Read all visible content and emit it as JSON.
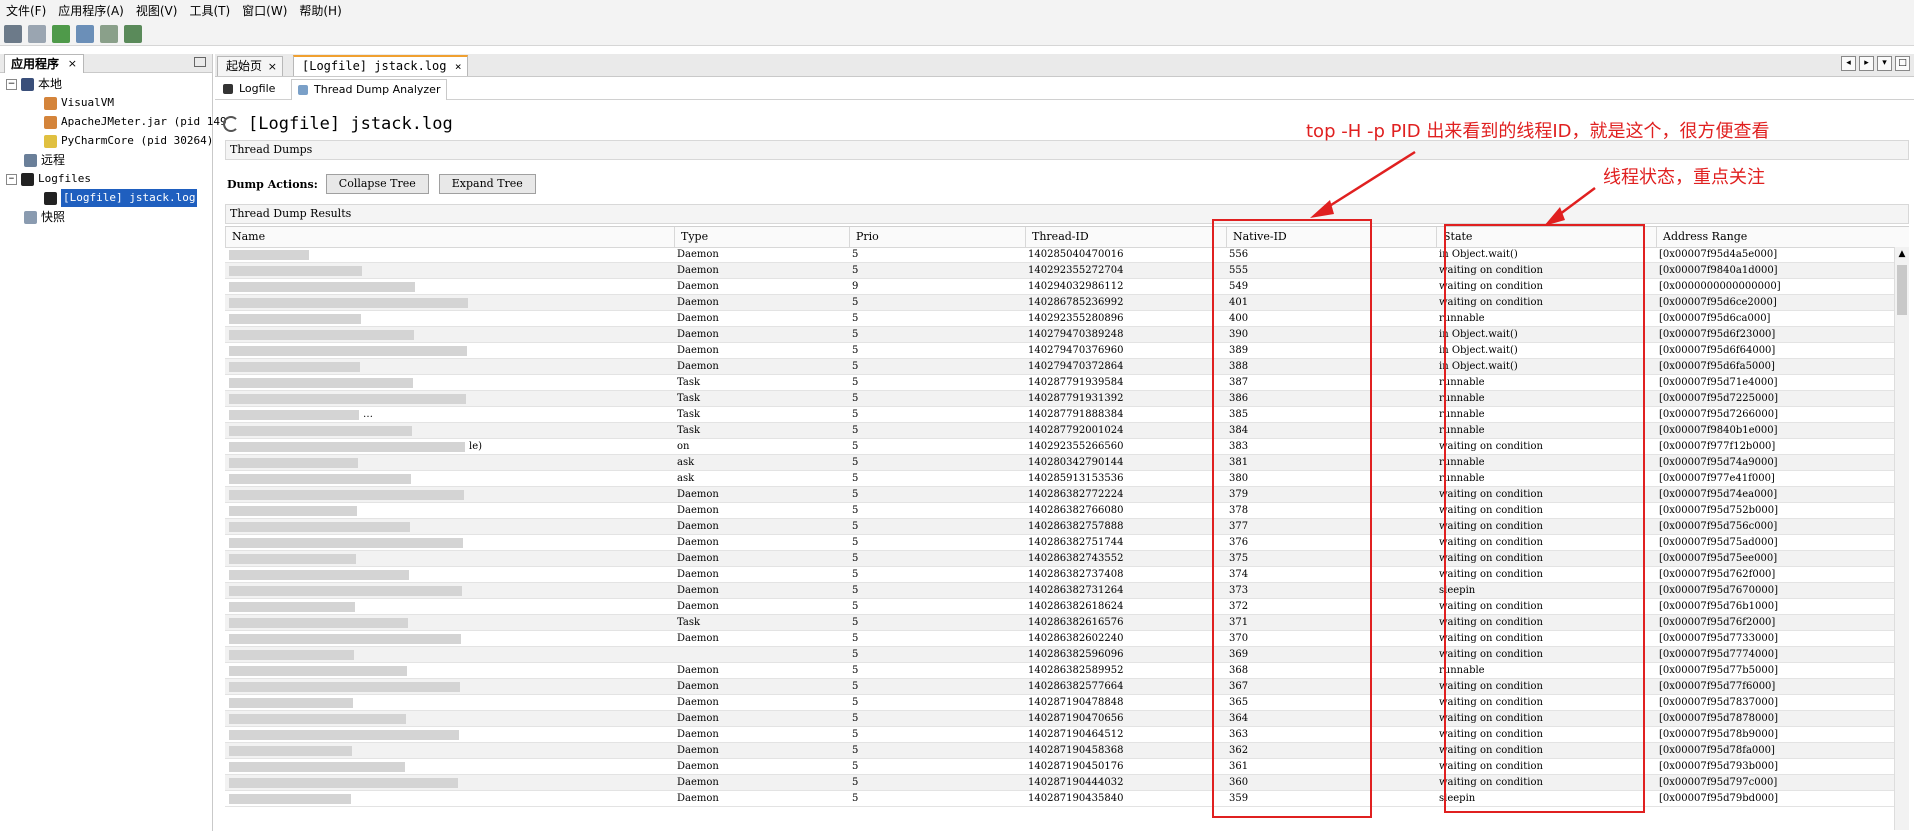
{
  "menu": [
    "文件(F)",
    "应用程序(A)",
    "视图(V)",
    "工具(T)",
    "窗口(W)",
    "帮助(H)"
  ],
  "left_panel": {
    "tab_label": "应用程序",
    "close_glyph": "×",
    "tree": {
      "local": "本地",
      "visualvm": "VisualVM",
      "jmeter": "ApacheJMeter.jar (pid 149",
      "pycharm": "PyCharmCore (pid 30264)",
      "remote": "远程",
      "logfiles": "Logfiles",
      "logfile_item": "[Logfile] jstack.log",
      "snapshots": "快照"
    }
  },
  "editor_tabs": [
    {
      "label": "起始页",
      "close": "×"
    },
    {
      "label": "[Logfile] jstack.log",
      "close": "×"
    }
  ],
  "sub_tabs": [
    "Logfile",
    "Thread Dump Analyzer"
  ],
  "page_title": "[Logfile] jstack.log",
  "thread_dumps_label": "Thread Dumps",
  "dump_actions": {
    "label": "Dump Actions:",
    "collapse": "Collapse Tree",
    "expand": "Expand Tree"
  },
  "results_label": "Thread Dump Results",
  "table": {
    "columns": [
      "Name",
      "Type",
      "Prio",
      "Thread-ID",
      "Native-ID",
      "State",
      "Address Range"
    ],
    "rows": [
      [
        "",
        "Daemon",
        "5",
        "140285040470016",
        "556",
        "in Object.wait()",
        "[0x00007f95d4a5e000]"
      ],
      [
        "",
        "Daemon",
        "5",
        "140292355272704",
        "555",
        "waiting on condition",
        "[0x00007f9840a1d000]"
      ],
      [
        "",
        "Daemon",
        "9",
        "140294032986112",
        "549",
        "waiting on condition",
        "[0x0000000000000000]"
      ],
      [
        "",
        "Daemon",
        "5",
        "140286785236992",
        "401",
        "waiting on condition",
        "[0x00007f95d6ce2000]"
      ],
      [
        "",
        "Daemon",
        "5",
        "140292355280896",
        "400",
        "runnable",
        "[0x00007f95d6ca000]"
      ],
      [
        "",
        "Daemon",
        "5",
        "140279470389248",
        "390",
        "in Object.wait()",
        "[0x00007f95d6f23000]"
      ],
      [
        "",
        "Daemon",
        "5",
        "140279470376960",
        "389",
        "in Object.wait()",
        "[0x00007f95d6f64000]"
      ],
      [
        "",
        "Daemon",
        "5",
        "140279470372864",
        "388",
        "in Object.wait()",
        "[0x00007f95d6fa5000]"
      ],
      [
        "",
        "Task",
        "5",
        "140287791939584",
        "387",
        "runnable",
        "[0x00007f95d71e4000]"
      ],
      [
        "",
        "Task",
        "5",
        "140287791931392",
        "386",
        "runnable",
        "[0x00007f95d7225000]"
      ],
      [
        "…",
        "Task",
        "5",
        "140287791888384",
        "385",
        "runnable",
        "[0x00007f95d7266000]"
      ],
      [
        "",
        "Task",
        "5",
        "140287792001024",
        "384",
        "runnable",
        "[0x00007f9840b1e000]"
      ],
      [
        "le)",
        "on",
        "5",
        "140292355266560",
        "383",
        "waiting on condition",
        "[0x00007f977f12b000]"
      ],
      [
        "",
        "ask",
        "5",
        "140280342790144",
        "381",
        "runnable",
        "[0x00007f95d74a9000]"
      ],
      [
        "",
        "ask",
        "5",
        "140285913153536",
        "380",
        "runnable",
        "[0x00007f977e41f000]"
      ],
      [
        "",
        "Daemon",
        "5",
        "140286382772224",
        "379",
        "waiting on condition",
        "[0x00007f95d74ea000]"
      ],
      [
        "",
        "Daemon",
        "5",
        "140286382766080",
        "378",
        "waiting on condition",
        "[0x00007f95d752b000]"
      ],
      [
        "",
        "Daemon",
        "5",
        "140286382757888",
        "377",
        "waiting on condition",
        "[0x00007f95d756c000]"
      ],
      [
        "",
        "Daemon",
        "5",
        "140286382751744",
        "376",
        "waiting on condition",
        "[0x00007f95d75ad000]"
      ],
      [
        "",
        "Daemon",
        "5",
        "140286382743552",
        "375",
        "waiting on condition",
        "[0x00007f95d75ee000]"
      ],
      [
        "",
        "Daemon",
        "5",
        "140286382737408",
        "374",
        "waiting on condition",
        "[0x00007f95d762f000]"
      ],
      [
        "",
        "Daemon",
        "5",
        "140286382731264",
        "373",
        "sleepin",
        "[0x00007f95d7670000]"
      ],
      [
        "",
        "Daemon",
        "5",
        "140286382618624",
        "372",
        "waiting on condition",
        "[0x00007f95d76b1000]"
      ],
      [
        "",
        "Task",
        "5",
        "140286382616576",
        "371",
        "waiting on condition",
        "[0x00007f95d76f2000]"
      ],
      [
        "",
        "Daemon",
        "5",
        "140286382602240",
        "370",
        "waiting on condition",
        "[0x00007f95d7733000]"
      ],
      [
        "",
        "",
        "5",
        "140286382596096",
        "369",
        "waiting on condition",
        "[0x00007f95d7774000]"
      ],
      [
        "",
        "Daemon",
        "5",
        "140286382589952",
        "368",
        "runnable",
        "[0x00007f95d77b5000]"
      ],
      [
        "",
        "Daemon",
        "5",
        "140286382577664",
        "367",
        "waiting on condition",
        "[0x00007f95d77f6000]"
      ],
      [
        "",
        "Daemon",
        "5",
        "140287190478848",
        "365",
        "waiting on condition",
        "[0x00007f95d7837000]"
      ],
      [
        "",
        "Daemon",
        "5",
        "140287190470656",
        "364",
        "waiting on condition",
        "[0x00007f95d7878000]"
      ],
      [
        "",
        "Daemon",
        "5",
        "140287190464512",
        "363",
        "waiting on condition",
        "[0x00007f95d78b9000]"
      ],
      [
        "",
        "Daemon",
        "5",
        "140287190458368",
        "362",
        "waiting on condition",
        "[0x00007f95d78fa000]"
      ],
      [
        "",
        "Daemon",
        "5",
        "140287190450176",
        "361",
        "waiting on condition",
        "[0x00007f95d793b000]"
      ],
      [
        "",
        "Daemon",
        "5",
        "140287190444032",
        "360",
        "waiting on condition",
        "[0x00007f95d797c000]"
      ],
      [
        "",
        "Daemon",
        "5",
        "140287190435840",
        "359",
        "sleepin",
        "[0x00007f95d79bd000]"
      ]
    ]
  },
  "annotations": {
    "native_id": "top -H -p PID 出来看到的线程ID，就是这个，很方便查看",
    "state": "线程状态，重点关注"
  },
  "colors": {
    "annotation_red": "#e02020",
    "selection_blue": "#1f5fbf",
    "active_tab_accent": "#f0a030"
  }
}
